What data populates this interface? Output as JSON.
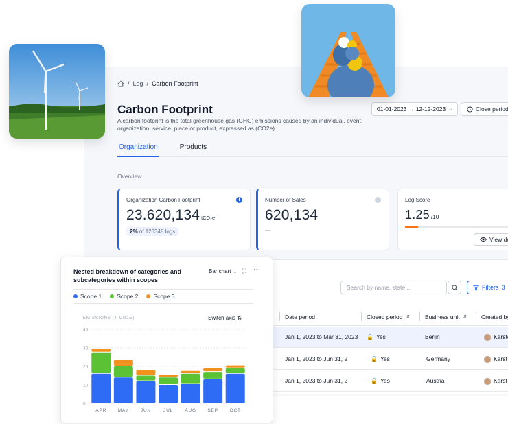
{
  "breadcrumb": {
    "items": [
      "Log",
      "Carbon Footprint"
    ]
  },
  "header": {
    "title": "Carbon Footprint",
    "description": "A carbon footprint is the total greenhouse gas (GHG) emissions caused by an individual, event, organization, service, place or product, expressed as (CO2e).",
    "date_range": "01-01-2023 → 12-12-2023",
    "close_period_label": "Close period"
  },
  "tabs": [
    {
      "label": "Organization",
      "active": true
    },
    {
      "label": "Products",
      "active": false
    }
  ],
  "overview": {
    "label": "Overview",
    "cards": [
      {
        "label": "Organization Carbon Footprint",
        "value": "23.620,134",
        "unit": "tCO₂e",
        "pct": "2%",
        "pct_suffix": "of 123348 logs"
      },
      {
        "label": "Number of Sales",
        "value": "620,134",
        "note": "—"
      },
      {
        "label": "Log Score",
        "value": "1.25",
        "suffix": "/10",
        "score_fraction": 0.125,
        "view_label": "View de"
      }
    ]
  },
  "table": {
    "search_placeholder": "Search by name, state ...",
    "filters_label": "Filters",
    "filters_count": "3",
    "columns": [
      "Date period",
      "Closed period",
      "Business unit",
      "Created by"
    ],
    "rows": [
      {
        "date_period": "Jan 1, 2023 to Mar 31, 2023",
        "closed": "Yes",
        "unit": "Berlin",
        "created_by": "Karste",
        "selected": true
      },
      {
        "date_period": "Jan 1, 2023 to Jun 31, 2",
        "closed": "Yes",
        "unit": "Germany",
        "created_by": "Karst",
        "selected": false
      },
      {
        "date_period": "Jan 1, 2023 to Jun 31, 2",
        "closed": "Yes",
        "unit": "Austria",
        "created_by": "Karst",
        "selected": false
      }
    ]
  },
  "chart_card": {
    "title": "Nested breakdown of categories and subcategories within scopes",
    "type_label": "Bar chart",
    "switch_axis_label": "Switch axis",
    "y_label": "EMISSIONS (T CO2E)"
  },
  "colors": {
    "scope1": "#2f6cf6",
    "scope2": "#5bc236",
    "scope3": "#f0931e",
    "accent": "#2563eb"
  },
  "chart_data": {
    "type": "bar",
    "stacked": true,
    "categories": [
      "APR",
      "MAY",
      "JUN",
      "JUL",
      "AUG",
      "SEP",
      "OCT"
    ],
    "series": [
      {
        "name": "Scope 1",
        "values": [
          16,
          14,
          12,
          10,
          10.5,
          13,
          16
        ]
      },
      {
        "name": "Scope 2",
        "values": [
          11.5,
          6,
          3,
          4,
          5.5,
          4,
          3
        ]
      },
      {
        "name": "Scope 3",
        "values": [
          2,
          3.5,
          3,
          1.5,
          1.5,
          2,
          1.5
        ]
      }
    ],
    "ylim": [
      0,
      40
    ],
    "yticks": [
      0,
      10,
      20,
      30,
      40
    ],
    "ylabel": "EMISSIONS (T CO2E)",
    "grid": true,
    "legend": "top-left"
  }
}
